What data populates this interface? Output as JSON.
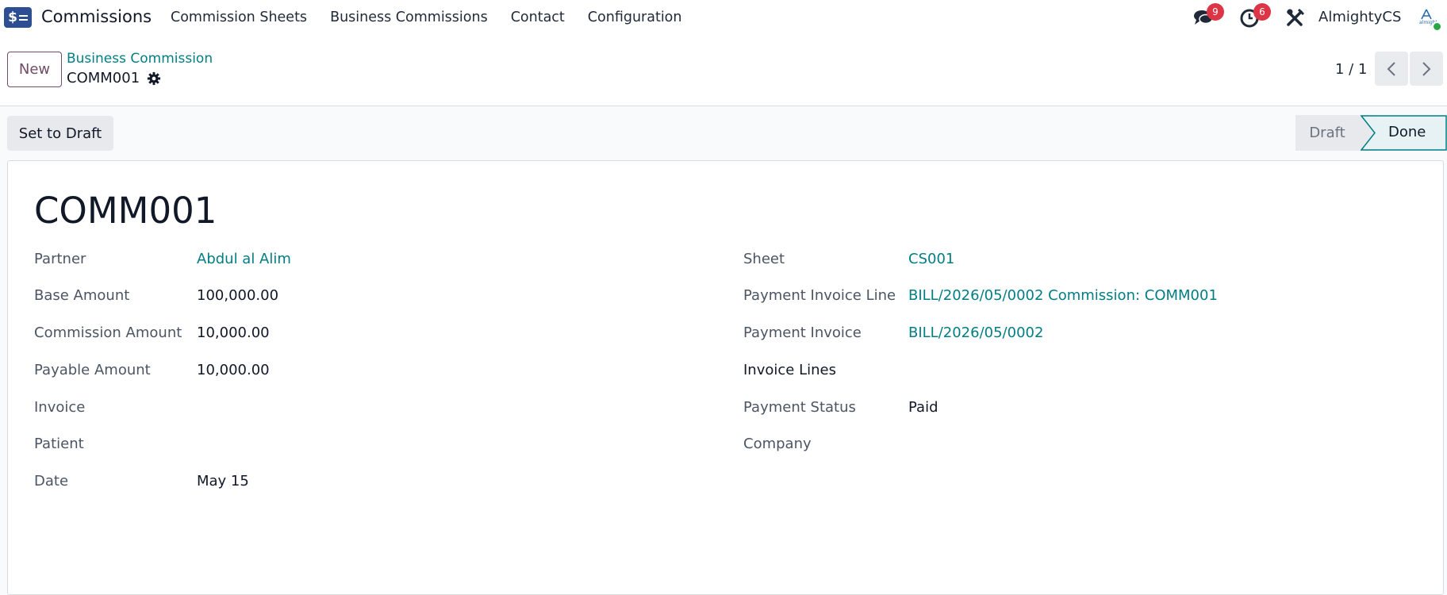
{
  "app": {
    "name": "Commissions",
    "menu": [
      "Commission Sheets",
      "Business Commissions",
      "Contact",
      "Configuration"
    ]
  },
  "systray": {
    "messages_count": "9",
    "activities_count": "6",
    "user_name": "AlmightyCS"
  },
  "control_panel": {
    "new_label": "New",
    "breadcrumb": "Business Commission",
    "record_name": "COMM001",
    "pager": "1 / 1"
  },
  "statusbar": {
    "set_to_draft_label": "Set to Draft",
    "stages": [
      "Draft",
      "Done"
    ],
    "current_stage": "Done"
  },
  "form": {
    "title": "COMM001",
    "left": [
      {
        "label": "Partner",
        "value": "Abdul al Alim",
        "link": true
      },
      {
        "label": "Base Amount",
        "value": "100,000.00"
      },
      {
        "label": "Commission Amount",
        "value": "10,000.00"
      },
      {
        "label": "Payable Amount",
        "value": "10,000.00"
      },
      {
        "label": "Invoice",
        "value": ""
      },
      {
        "label": "Patient",
        "value": ""
      },
      {
        "label": "Date",
        "value": "May 15"
      }
    ],
    "right": [
      {
        "label": "Sheet",
        "value": "CS001",
        "link": true
      },
      {
        "label": "Payment Invoice Line",
        "value": "BILL/2026/05/0002 Commission: COMM001",
        "link": true
      },
      {
        "label": "Payment Invoice",
        "value": "BILL/2026/05/0002",
        "link": true
      },
      {
        "label": "Invoice Lines",
        "value": ""
      },
      {
        "label": "Payment Status",
        "value": "Paid"
      },
      {
        "label": "Company",
        "value": ""
      }
    ]
  },
  "colors": {
    "accent": "#017e84",
    "brand": "#714b67",
    "badge": "#dc3545"
  }
}
